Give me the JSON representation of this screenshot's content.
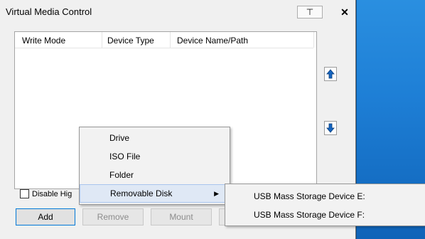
{
  "window": {
    "title": "Virtual Media Control",
    "pin_label": "⊤",
    "close_label": "✕"
  },
  "list": {
    "columns": [
      "Write Mode",
      "Device Type",
      "Device Name/Path"
    ]
  },
  "checkbox": {
    "label": "Disable Hig"
  },
  "buttons": {
    "add": "Add",
    "remove": "Remove",
    "mount": "Mount"
  },
  "context_menu": {
    "items": [
      "Drive",
      "ISO File",
      "Folder",
      "Removable Disk"
    ],
    "submenu_items": [
      "USB Mass Storage Device E:",
      "USB Mass Storage Device F:"
    ]
  },
  "colors": {
    "desktop": "#1e7fd6",
    "arrow_icon": "#1565c0",
    "menu_highlight": "#dfe8f5"
  },
  "icons": {
    "move_up": "arrow-up-icon",
    "move_down": "arrow-down-icon",
    "submenu": "chevron-right-icon"
  }
}
